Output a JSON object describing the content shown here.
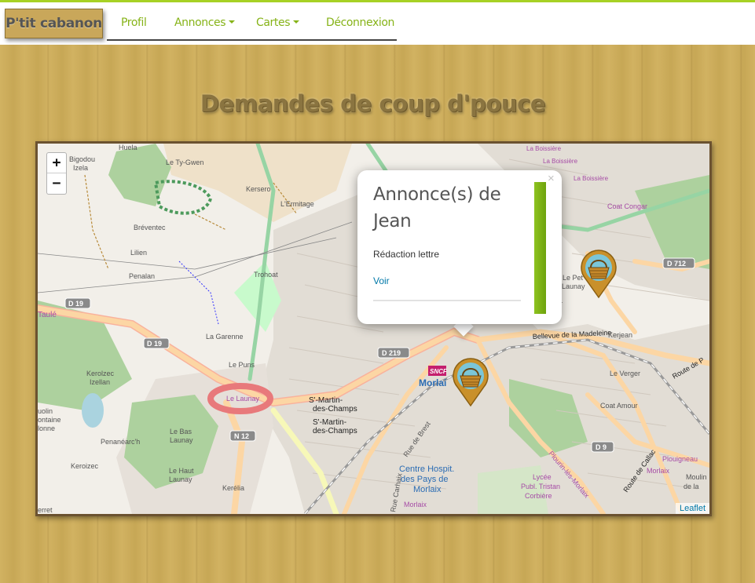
{
  "navbar": {
    "brand": "P'tit cabanon",
    "items": [
      {
        "label": "Profil",
        "dropdown": false
      },
      {
        "label": "Annonces",
        "dropdown": true
      },
      {
        "label": "Cartes",
        "dropdown": true
      },
      {
        "label": "Déconnexion",
        "dropdown": false
      }
    ]
  },
  "page": {
    "title": "Demandes de coup d'pouce"
  },
  "map": {
    "zoom_in": "+",
    "zoom_out": "−",
    "attribution": "Leaflet",
    "labels": {
      "huela": "Huela",
      "bigodou": "Bigodou",
      "izela": "Izela",
      "le_ty_gwen": "Le Ty-Gwen",
      "kersero": "Kersero",
      "l_ermitage": "L'Ermitage",
      "breventec": "Bréventec",
      "lilien": "Lilien",
      "penalan": "Penalan",
      "trohoat": "Trohoat",
      "taule": "Taulé",
      "d19a": "D 19",
      "d19b": "D 19",
      "la_garenne": "La Garenne",
      "le_puns": "Le Puns",
      "kerolzec": "Kerolzec",
      "izellan": "Izellan",
      "le_launay": "Le Launay",
      "uolin": "uolin",
      "ontaine": "ontaine",
      "lonne": "lonne",
      "le_bas_launay_1": "Le Bas",
      "le_bas_launay_2": "Launay",
      "penanearch": "Penanéarc'h",
      "n12": "N 12",
      "keroizec": "Keroizec",
      "le_haut_launay_1": "Le Haut",
      "le_haut_launay_2": "Launay",
      "kerelia": "Kerélia",
      "erret": "erret",
      "st_martin_1": "S'-Martin-",
      "st_martin_2": "des-Champs",
      "st_martin_3": "S'-Martin-",
      "st_martin_4": "des-Champs",
      "d219": "D 219",
      "morlai": "Morlai",
      "sncf": "SNCF",
      "rue_de_brest": "Rue de Brest",
      "rue_carhaix": "Rue Carhaix",
      "centre_hosp_1": "Centre Hospit.",
      "centre_hosp_2": "des Pays de",
      "centre_hosp_3": "Morlaix",
      "morlaix_small": "Morlaix",
      "lycee_1": "Lycée",
      "lycee_2": "Publ. Tristan",
      "lycee_3": "Corbière",
      "la_boissiere_1": "La Boissière",
      "la_boissiere_2": "La Boissière",
      "la_boissiere_3": "La Boissière",
      "coat_congar": "Coat Congar",
      "d712": "D 712",
      "le_pet": "Le Pet",
      "launay_r": "Launay",
      "er": "er",
      "bellevue": "Bellevue de la Madeleine",
      "kerjean": "Kerjean",
      "le_verger": "Le Verger",
      "route_de_p": "Route de P",
      "coat_amour": "Coat Amour",
      "d9": "D 9",
      "plourin": "Plourin-lès-Morlaix",
      "route_de_callac": "Route de Callac",
      "plouigneau": "Plouigneau",
      "moulin": "Moulin",
      "morlaix_r": "Morlaix",
      "de_la": "de la"
    }
  },
  "popup": {
    "title": "Annonce(s) de Jean",
    "text": "Rédaction lettre",
    "link": "Voir",
    "close": "×"
  },
  "markers": [
    {
      "name": "basket-marker"
    },
    {
      "name": "basket-marker"
    }
  ]
}
